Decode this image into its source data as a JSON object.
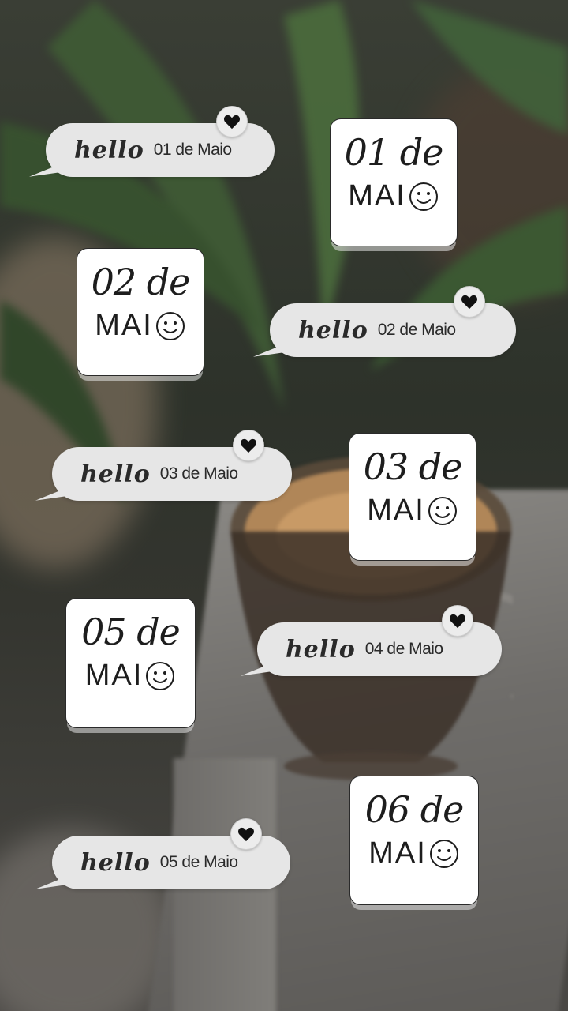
{
  "bubbles": [
    {
      "hello": "hello",
      "date": "01 de Maio",
      "icon": "heart-icon"
    },
    {
      "hello": "hello",
      "date": "02 de Maio",
      "icon": "heart-icon"
    },
    {
      "hello": "hello",
      "date": "03 de Maio",
      "icon": "heart-icon"
    },
    {
      "hello": "hello",
      "date": "04 de Maio",
      "icon": "heart-icon"
    },
    {
      "hello": "hello",
      "date": "05 de Maio",
      "icon": "heart-icon"
    }
  ],
  "cards": [
    {
      "day": "01 de",
      "month": "MAI",
      "icon": "smiley-icon"
    },
    {
      "day": "02 de",
      "month": "MAI",
      "icon": "smiley-icon"
    },
    {
      "day": "03 de",
      "month": "MAI",
      "icon": "smiley-icon"
    },
    {
      "day": "05 de",
      "month": "MAI",
      "icon": "smiley-icon"
    },
    {
      "day": "06 de",
      "month": "MAI",
      "icon": "smiley-icon"
    }
  ],
  "colors": {
    "bubble": "#e6e6e6",
    "card": "#ffffff",
    "ink": "#1d1d1d"
  }
}
